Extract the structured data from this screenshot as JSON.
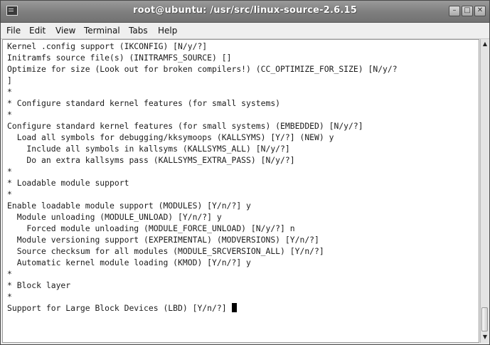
{
  "window": {
    "title": "root@ubuntu: /usr/src/linux-source-2.6.15",
    "buttons": {
      "minimize": "–",
      "maximize": "□",
      "close": "✕"
    }
  },
  "menu": [
    {
      "label": "File"
    },
    {
      "label": "Edit"
    },
    {
      "label": "View"
    },
    {
      "label": "Terminal"
    },
    {
      "label": "Tabs"
    },
    {
      "label": "Help"
    }
  ],
  "terminal": {
    "lines": [
      "Kernel .config support (IKCONFIG) [N/y/?]",
      "Initramfs source file(s) (INITRAMFS_SOURCE) []",
      "Optimize for size (Look out for broken compilers!) (CC_OPTIMIZE_FOR_SIZE) [N/y/?",
      "]",
      "*",
      "* Configure standard kernel features (for small systems)",
      "*",
      "Configure standard kernel features (for small systems) (EMBEDDED) [N/y/?]",
      "  Load all symbols for debugging/kksymoops (KALLSYMS) [Y/?] (NEW) y",
      "    Include all symbols in kallsyms (KALLSYMS_ALL) [N/y/?]",
      "    Do an extra kallsyms pass (KALLSYMS_EXTRA_PASS) [N/y/?]",
      "*",
      "* Loadable module support",
      "*",
      "Enable loadable module support (MODULES) [Y/n/?] y",
      "  Module unloading (MODULE_UNLOAD) [Y/n/?] y",
      "    Forced module unloading (MODULE_FORCE_UNLOAD) [N/y/?] n",
      "  Module versioning support (EXPERIMENTAL) (MODVERSIONS) [Y/n/?]",
      "  Source checksum for all modules (MODULE_SRCVERSION_ALL) [Y/n/?]",
      "  Automatic kernel module loading (KMOD) [Y/n/?] y",
      "*",
      "* Block layer",
      "*",
      "Support for Large Block Devices (LBD) [Y/n/?] "
    ]
  }
}
